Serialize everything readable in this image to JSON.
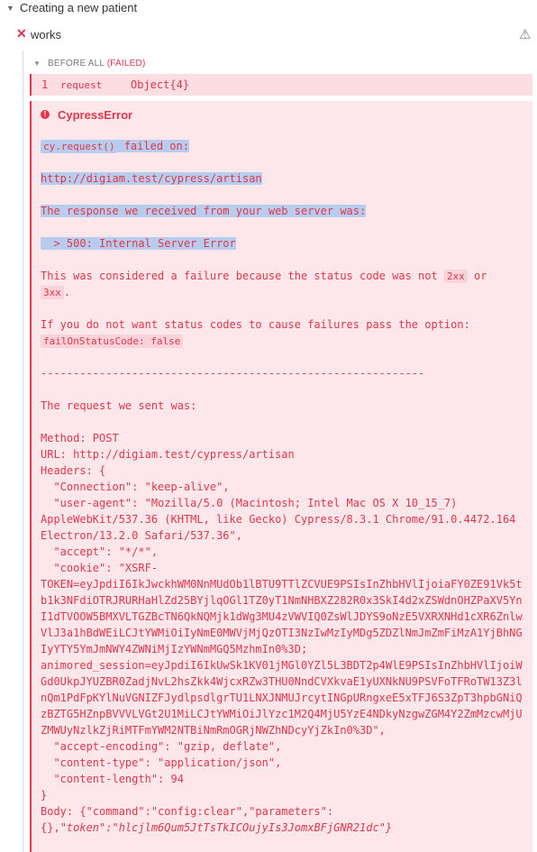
{
  "suite": {
    "title": "Creating a new patient"
  },
  "test": {
    "title": "works"
  },
  "hook": {
    "label": "BEFORE ALL",
    "status": "(FAILED)"
  },
  "command": {
    "number": "1",
    "name": "request",
    "message": "Object{4}"
  },
  "error": {
    "name": "CypressError",
    "cmd_code": "cy.request()",
    "cmd_suffix": " failed on:",
    "url": "http://digiam.test/cypress/artisan",
    "response_intro": "The response we received from your web server was:",
    "status_line": "  > 500: Internal Server Error",
    "failure_pre": "This was considered a failure because the status code was not ",
    "code_2xx": "2xx",
    "failure_or": " or",
    "code_3xx": "3xx",
    "failure_end": ".",
    "option_intro": "If you do not want status codes to cause failures pass the option:",
    "option_code": "failOnStatusCode: false",
    "separator": "-----------------------------------------------------------",
    "request_intro": "The request we sent was:",
    "request_lines": [
      "Method: POST",
      "URL: http://digiam.test/cypress/artisan",
      "Headers: {",
      "  \"Connection\": \"keep-alive\",",
      "  \"user-agent\": \"Mozilla/5.0 (Macintosh; Intel Mac OS X 10_15_7)",
      "AppleWebKit/537.36 (KHTML, like Gecko) Cypress/8.3.1 Chrome/91.0.4472.164",
      "Electron/13.2.0 Safari/537.36\",",
      "  \"accept\": \"*/*\",",
      "  \"cookie\": \"XSRF-",
      "TOKEN=eyJpdiI6IkJwckhWM0NnMUdOb1lBTU9TTlZCVUE9PSIsInZhbHVlIjoiaFY0ZE91Vk5t",
      "b1k3NFdiOTRJRURHaHlZd25BYjlqOGl1TZ0yT1NmNHBXZ282R0x3SkI4d2xZSWdnOHZPaXV5Yn",
      "I1dTVOOW5BMXVLTGZBcTN6QkNQMjk1dWg3MU4zVWVIQ0ZsWlJDYS9oNzE5VXRXNHd1cXR6Znlw",
      "VlJ3a1hBdWEiLCJtYWMiOiIyNmE0MWVjMjQzOTI3NzIwMzIyMDg5ZDZlNmJmZmFiMzA1YjBhNG",
      "IyYTY5YmJmNWY4ZWNiMjIzYWNmMGQ5MzhmIn0%3D;",
      "animored_session=eyJpdiI6IkUwSk1KV01jMGl0YZl5L3BDT2p4WlE9PSIsInZhbHVlIjoiW",
      "Gd0UkpJYUZBR0ZadjNvL2hsZkk4WjcxRZw3THU0NndCVXkvaE1yUXNkNU9PSVFoTFRoTW13Z3l",
      "nQm1PdFpKYlNuVGNIZFJydlpsdlgrTU1LNXJNMUJrcytINGpURngxeE5xTFJ6S3ZpT3hpbGNiQ",
      "zBZTG5HZnpBVVVLVGt2U1MiLCJtYWMiOiJlYzc1M2Q4MjU5YzE4NDkyNzgwZGM4Y2ZmMzcwMjU",
      "ZMWUyNzlkZjRiMTFmYWM2NTBiNmRmOGRjNWZhNDcyYjZkIn0%3D\",",
      "  \"accept-encoding\": \"gzip, deflate\",",
      "  \"content-type\": \"application/json\",",
      "  \"content-length\": 94",
      "}"
    ],
    "body_line1": "Body: {\"command\":\"config:clear\",\"parameters\":",
    "body_line2_pre": "{},",
    "body_line2_token": "\"token\":\"hlcjlm6Qum5JtTsTkICOujyIs3JomxBFjGNR21dc\"}"
  },
  "colors": {
    "error": "#e0364c",
    "panel": "#fde7ea",
    "selection": "#b8cdee"
  },
  "icons": {
    "suite_toggle": "chevron-down-icon",
    "fail": "x-icon",
    "warning": "warning-triangle-icon",
    "error": "exclamation-circle-icon"
  }
}
